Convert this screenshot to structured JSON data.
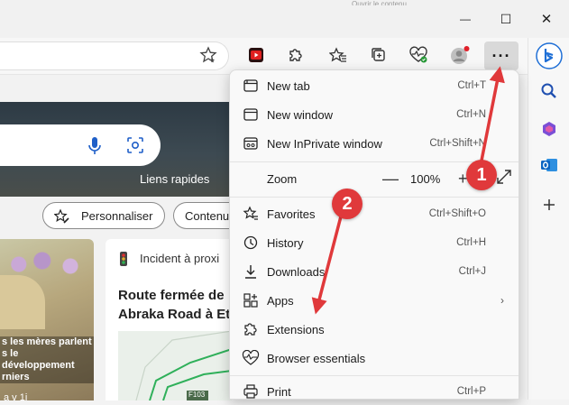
{
  "window": {
    "minimize_glyph": "—",
    "maximize_glyph": "☐",
    "close_glyph": "✕",
    "top_edge_text": "Ouvrir le contenu"
  },
  "toolbar": {
    "more_label": "···",
    "icons": [
      "youtube-icon",
      "extension-puzzle-icon",
      "favorites-icon",
      "collections-icon",
      "browser-essentials-icon",
      "profile-avatar-icon"
    ]
  },
  "page": {
    "quick_links": "Liens rapides",
    "personalize": "Personnaliser",
    "content_pill": "Contenu",
    "card_left_caption": "s les mères parlent s le développement rniers",
    "card_left_footer": "a v 1j",
    "card_right_tag": "Incident à proxi",
    "card_right_headline": "Route fermée de Abraka Road à Et",
    "map_label": "F103"
  },
  "menu": {
    "items": [
      {
        "label": "New tab",
        "shortcut": "Ctrl+T",
        "icon": "new-tab-icon"
      },
      {
        "label": "New window",
        "shortcut": "Ctrl+N",
        "icon": "new-window-icon"
      },
      {
        "label": "New InPrivate window",
        "shortcut": "Ctrl+Shift+N",
        "icon": "inprivate-icon"
      },
      {
        "label": "Zoom",
        "value": "100%",
        "minus": "—",
        "plus": "+"
      },
      {
        "label": "Favorites",
        "shortcut": "Ctrl+Shift+O",
        "icon": "favorites-star-icon"
      },
      {
        "label": "History",
        "shortcut": "Ctrl+H",
        "icon": "history-icon"
      },
      {
        "label": "Downloads",
        "shortcut": "Ctrl+J",
        "icon": "download-icon"
      },
      {
        "label": "Apps",
        "shortcut": "",
        "icon": "apps-icon",
        "chevron": "›"
      },
      {
        "label": "Extensions",
        "shortcut": "",
        "icon": "extensions-icon"
      },
      {
        "label": "Browser essentials",
        "shortcut": "",
        "icon": "heart-pulse-icon"
      },
      {
        "label": "Print",
        "shortcut": "Ctrl+P",
        "icon": "print-icon"
      }
    ]
  },
  "annotations": {
    "badge1": "1",
    "badge2": "2",
    "color": "#e0393b"
  },
  "colors": {
    "bing_blue": "#1f6fd6",
    "outlook_blue": "#0a64c2",
    "youtube_red": "#e02020"
  }
}
